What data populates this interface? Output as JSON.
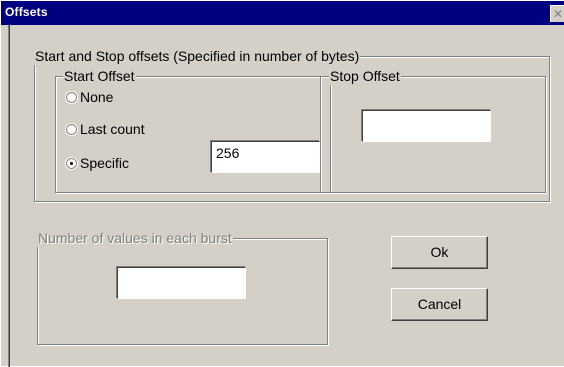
{
  "window": {
    "title": "Offsets",
    "close_glyph": "✕"
  },
  "offsets_group": {
    "legend": "Start and Stop offsets (Specified in number of bytes)",
    "start_offset": {
      "legend": "Start Offset",
      "options": [
        {
          "label": "None",
          "checked": false
        },
        {
          "label": "Last count",
          "checked": false
        },
        {
          "label": "Specific",
          "checked": true
        }
      ],
      "specific_value": "256"
    },
    "stop_offset": {
      "legend": "Stop Offset",
      "value": ""
    }
  },
  "burst_group": {
    "legend": "Number of values in each burst",
    "enabled": false,
    "value": ""
  },
  "buttons": {
    "ok_label": "Ok",
    "cancel_label": "Cancel"
  },
  "colors": {
    "titlebar": "#000080",
    "face": "#d4d0c8"
  }
}
